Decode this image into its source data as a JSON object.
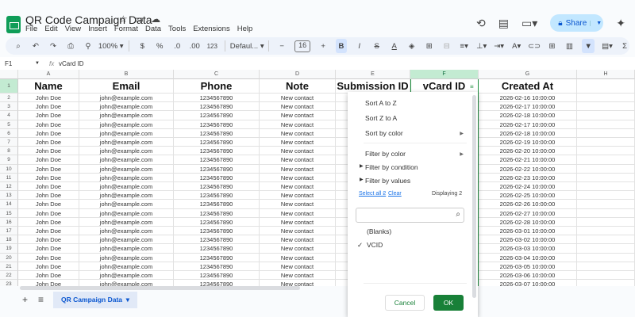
{
  "doc": {
    "title": "QR Code Campaign Data",
    "menu": [
      "File",
      "Edit",
      "View",
      "Insert",
      "Format",
      "Data",
      "Tools",
      "Extensions",
      "Help"
    ],
    "share": "Share"
  },
  "toolbar": {
    "zoom": "100%",
    "currency": "$",
    "percent": "%",
    "dec_less": ".0",
    "dec_more": ".00",
    "format": "123",
    "font": "Defaul...",
    "font_size": "16",
    "bold": "B",
    "italic": "I",
    "sum": "Σ"
  },
  "formula": {
    "cell_ref": "F1",
    "fx": "fx",
    "value": "vCard ID"
  },
  "columns": [
    "A",
    "B",
    "C",
    "D",
    "E",
    "F",
    "G",
    "H"
  ],
  "headers": [
    "Name",
    "Email",
    "Phone",
    "Note",
    "Submission ID",
    "vCard ID",
    "Created At",
    ""
  ],
  "rows": [
    [
      "John Doe",
      "john@example.com",
      "1234567890",
      "New contact",
      "",
      "",
      "2026-02-16 10:00:00"
    ],
    [
      "John Doe",
      "john@example.com",
      "1234567890",
      "New contact",
      "",
      "",
      "2026-02-17 10:00:00"
    ],
    [
      "John Doe",
      "john@example.com",
      "1234567890",
      "New contact",
      "",
      "",
      "2026-02-18 10:00:00"
    ],
    [
      "John Doe",
      "john@example.com",
      "1234567890",
      "New contact",
      "",
      "",
      "2026-02-17 10:00:00"
    ],
    [
      "John Doe",
      "john@example.com",
      "1234567890",
      "New contact",
      "",
      "",
      "2026-02-18 10:00:00"
    ],
    [
      "John Doe",
      "john@example.com",
      "1234567890",
      "New contact",
      "",
      "",
      "2026-02-19 10:00:00"
    ],
    [
      "John Doe",
      "john@example.com",
      "1234567890",
      "New contact",
      "",
      "",
      "2026-02-20 10:00:00"
    ],
    [
      "John Doe",
      "john@example.com",
      "1234567890",
      "New contact",
      "",
      "",
      "2026-02-21 10:00:00"
    ],
    [
      "John Doe",
      "john@example.com",
      "1234567890",
      "New contact",
      "",
      "",
      "2026-02-22 10:00:00"
    ],
    [
      "John Doe",
      "john@example.com",
      "1234567890",
      "New contact",
      "",
      "",
      "2026-02-23 10:00:00"
    ],
    [
      "John Doe",
      "john@example.com",
      "1234567890",
      "New contact",
      "",
      "",
      "2026-02-24 10:00:00"
    ],
    [
      "John Doe",
      "john@example.com",
      "1234567890",
      "New contact",
      "",
      "",
      "2026-02-25 10:00:00"
    ],
    [
      "John Doe",
      "john@example.com",
      "1234567890",
      "New contact",
      "",
      "",
      "2026-02-26 10:00:00"
    ],
    [
      "John Doe",
      "john@example.com",
      "1234567890",
      "New contact",
      "",
      "",
      "2026-02-27 10:00:00"
    ],
    [
      "John Doe",
      "john@example.com",
      "1234567890",
      "New contact",
      "",
      "",
      "2026-02-28 10:00:00"
    ],
    [
      "John Doe",
      "john@example.com",
      "1234567890",
      "New contact",
      "",
      "",
      "2026-03-01 10:00:00"
    ],
    [
      "John Doe",
      "john@example.com",
      "1234567890",
      "New contact",
      "",
      "",
      "2026-03-02 10:00:00"
    ],
    [
      "John Doe",
      "john@example.com",
      "1234567890",
      "New contact",
      "",
      "",
      "2026-03-03 10:00:00"
    ],
    [
      "John Doe",
      "john@example.com",
      "1234567890",
      "New contact",
      "",
      "",
      "2026-03-04 10:00:00"
    ],
    [
      "John Doe",
      "john@example.com",
      "1234567890",
      "New contact",
      "",
      "",
      "2026-03-05 10:00:00"
    ],
    [
      "John Doe",
      "john@example.com",
      "1234567890",
      "New contact",
      "",
      "",
      "2026-03-06 10:00:00"
    ],
    [
      "John Doe",
      "john@example.com",
      "1234567890",
      "New contact",
      "",
      "",
      "2026-03-07 10:00:00"
    ]
  ],
  "filter_menu": {
    "sort_az": "Sort A to Z",
    "sort_za": "Sort Z to A",
    "sort_color": "Sort by color",
    "filter_color": "Filter by color",
    "filter_condition": "Filter by condition",
    "filter_values": "Filter by values",
    "select_all": "Select all 2",
    "dash": " - ",
    "clear": "Clear",
    "displaying": "Displaying 2",
    "values": [
      {
        "label": "(Blanks)",
        "checked": false
      },
      {
        "label": "VCID",
        "checked": true
      }
    ],
    "check": "✓",
    "cancel": "Cancel",
    "ok": "OK"
  },
  "sheet_tab": "QR Campaign Data",
  "colors": {
    "accent": "#188038",
    "share_bg": "#c2e7ff"
  }
}
